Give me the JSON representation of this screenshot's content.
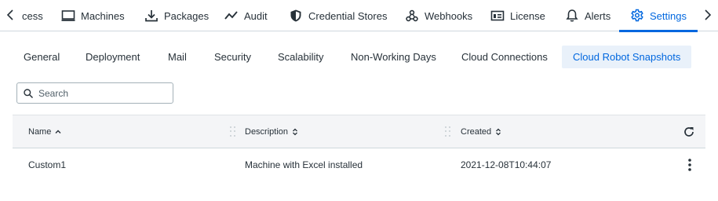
{
  "topnav": {
    "tabs": [
      {
        "label": "cess",
        "icon": "none"
      },
      {
        "label": "Machines",
        "icon": "monitor-icon"
      },
      {
        "label": "Packages",
        "icon": "download-icon"
      },
      {
        "label": "Audit",
        "icon": "trend-icon"
      },
      {
        "label": "Credential Stores",
        "icon": "shield-icon"
      },
      {
        "label": "Webhooks",
        "icon": "webhook-icon"
      },
      {
        "label": "License",
        "icon": "license-icon"
      },
      {
        "label": "Alerts",
        "icon": "bell-icon"
      },
      {
        "label": "Settings",
        "icon": "gear-icon",
        "active": true
      }
    ]
  },
  "subtabs": [
    {
      "label": "General"
    },
    {
      "label": "Deployment"
    },
    {
      "label": "Mail"
    },
    {
      "label": "Security"
    },
    {
      "label": "Scalability"
    },
    {
      "label": "Non-Working Days"
    },
    {
      "label": "Cloud Connections"
    },
    {
      "label": "Cloud Robot Snapshots",
      "active": true
    }
  ],
  "search": {
    "placeholder": "Search",
    "value": ""
  },
  "table": {
    "columns": [
      "Name",
      "Description",
      "Created"
    ],
    "rows": [
      {
        "name": "Custom1",
        "description": "Machine with Excel installed",
        "created": "2021-12-08T10:44:07"
      }
    ]
  },
  "colors": {
    "accent": "#0067df",
    "text": "#273139",
    "header_bg": "#f4f5f7",
    "active_subtab_bg": "#e9f1fa"
  }
}
